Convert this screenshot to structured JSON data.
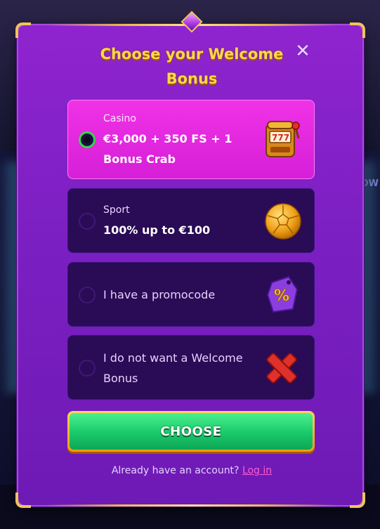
{
  "modal": {
    "title": "Choose your Welcome Bonus",
    "close_icon": "close-icon"
  },
  "options": [
    {
      "category": "Casino",
      "text": "€3,000 + 350 FS + 1 Bonus Crab",
      "icon": "slot-machine-icon",
      "selected": true
    },
    {
      "category": "Sport",
      "text": "100% up to €100",
      "icon": "soccer-ball-icon",
      "selected": false
    },
    {
      "category": "",
      "text": "I have a promocode",
      "icon": "percent-tag-icon",
      "selected": false
    },
    {
      "category": "",
      "text": "I do not want a Welcome Bonus",
      "icon": "red-x-icon",
      "selected": false
    }
  ],
  "choose_button": {
    "label": "CHOOSE"
  },
  "footer": {
    "question": "Already have an account?",
    "login_label": "Log in"
  },
  "background": {
    "side_text": "OW"
  },
  "colors": {
    "modal_bg": "#8f24cf",
    "selected_option": "#f032e6",
    "option_bg": "#2a0b55",
    "title_gold": "#ffd84a",
    "button_green": "#19c96a",
    "radio_selected": "#36d64a",
    "link_pink": "#ff5cd1"
  }
}
